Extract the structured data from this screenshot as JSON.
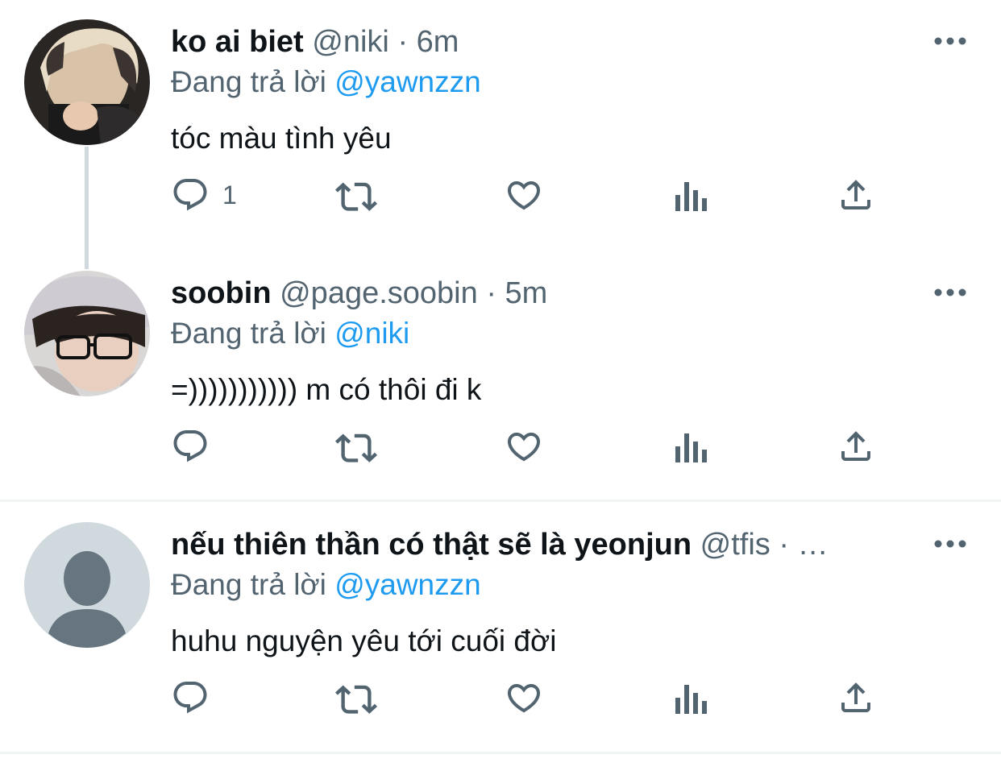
{
  "colors": {
    "text_primary": "#0f1419",
    "text_secondary": "#536471",
    "link": "#1d9bf0",
    "divider": "#eff3f4",
    "thread_line": "#cfd9de"
  },
  "tweets": [
    {
      "display_name": "ko ai biet",
      "handle": "@niki",
      "separator": "·",
      "time": "6m",
      "reply_prefix": "Đang trả lời",
      "reply_mention": "@yawnzzn",
      "text": "tóc màu tình yêu",
      "reply_count": "1",
      "avatar_icon": "user-photo-avatar"
    },
    {
      "display_name": "soobin",
      "handle": "@page.soobin",
      "separator": "·",
      "time": "5m",
      "reply_prefix": "Đang trả lời",
      "reply_mention": "@niki",
      "text": "=))))))))))) m có thôi đi k",
      "reply_count": "",
      "avatar_icon": "user-photo-avatar"
    },
    {
      "display_name": "nếu thiên thần có thật sẽ là yeonjun",
      "handle": "@tfis",
      "separator": "·",
      "time": "…",
      "reply_prefix": "Đang trả lời",
      "reply_mention": "@yawnzzn",
      "text": "huhu nguyện yêu tới cuối đời",
      "reply_count": "",
      "avatar_icon": "default-avatar-icon"
    }
  ],
  "icons": {
    "reply": "reply-icon",
    "retweet": "retweet-icon",
    "like": "heart-icon",
    "analytics": "analytics-icon",
    "share": "share-icon",
    "more": "more-icon"
  }
}
